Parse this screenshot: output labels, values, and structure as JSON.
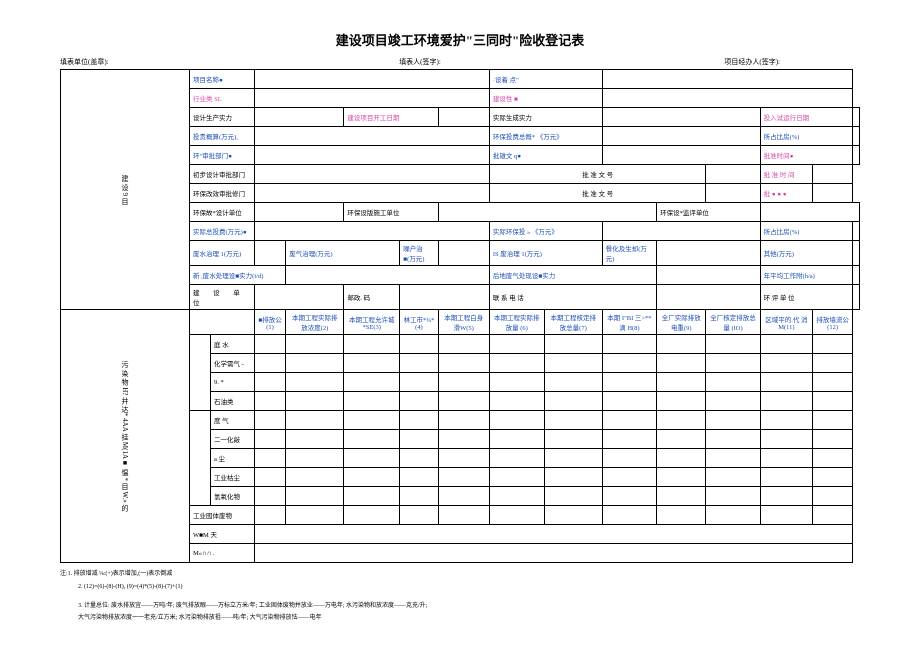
{
  "title": "建设项目竣工环境爱护\"三同时\"险收登记表",
  "header": {
    "h1": "填表单位(盖章):",
    "h2": "填表人(签字):",
    "h3": "项目经办人(签字):"
  },
  "sideA": "建 设 9 目",
  "sideB": "建 设 单 位",
  "sideC": "污 染 物 H? 并 达* 4AA 挂 M(1A■ 愠 * 目 W.» 的",
  "r": {
    "项目名称": "项目名称●",
    "设着点": "·设着          点\"",
    "行业类": "行业类 SL",
    "建设性": "建设性 ■",
    "设计生产实力": "设计生产实力",
    "建设项目开工日期": "建设项目开工日期",
    "实际生成实力": "实际生成实力",
    "投入试运行日期": "投入试运行日期",
    "投贵概算": "投贵概算(万元),",
    "环保投费总慨": "环保投费总慨* 《万元》",
    "所占比房": "所占比房(%)",
    "环审批部门": "环\"审批部门●",
    "批雄文": "批雄文 q●",
    "批准时间": "批准时间●",
    "初步设计审批部门": "初步设计审批部门",
    "批准文号1": "批    准    文    号",
    "批准时间2": "批   准   时   间",
    "环保改效审批修门": "环保改效审批修门",
    "批准文号2": "批    准    文    号",
    "批3": "批   ●   ●   ●",
    "环保故设计单位": "环保故*设计单位",
    "环保设版施工单位": "环保设版施工单位",
    "环保设监评单位": "环保设*监评单位",
    "实际总投费": "实际总投费(万元)●",
    "实际环保投": "实际环保投          » 《万元》",
    "所占比房2": "所占比房(%)",
    "废水治理": "废水治理 1(万元)",
    "废气治理": "废气治理(万元)",
    "噪户治": "噪户治■(万元)",
    "IS废治理": "IS 废治理 1(万元)",
    "餐化及生却": "餐化及生却(万元)",
    "其他": "其他(万元)",
    "新废水处理设": "新 ,废水处理设■实力(t/d)",
    "后地废气处现设": "后地废气处现设■实力",
    "年平均工作附": "年平均工作附(h/a)",
    "邮政码": "邮政. 码",
    "联系电话": "联   系   电   话",
    "环评单位": "环  评  单  位"
  },
  "cols": {
    "c1": "■排放公 (1)",
    "c2": "本期工程实际排放浓度(2)",
    "c3": "本期工程允许城*SE(3)",
    "c4": "林工市*¾* (4)",
    "c5": "本期工程白身滑W(5)",
    "c6": "本期工程实际排放量 (6)",
    "c7": "本期工程核定排放总量(7)",
    "c8": "本期 I\"BI 三>**滴 H(8)",
    "c9": "全厂实际排放电重(9)",
    "c10": "全厂核定排放总量 (IO)",
    "c11": "区域平的.代 消 M(11)",
    "c12": "排放墙流公(12)"
  },
  "rows": [
    "庭        水",
    "化学需气 -",
    "9.    *",
    "石油类",
    "度        气",
    "二一化敲",
    "a        尘",
    "工业枯尘",
    "氢氧化物",
    "工业囮体废物",
    "W■M 天",
    "M«∩∩ ."
  ],
  "notes": {
    "n1": "注:1. 排放增减 ⅛:(+)表示增加,(一)表示倒减",
    "n2": "2. (12)=(6)-(8)-(H), (9)=(4)*(5)-(8)-(7)+(1)",
    "n3": "3. 计量总位: 废水排放宜——万吨/年; 废气排放眼——万标立方米/年; 工业固体废物并放业——万电年; 水污染物和放浓度——克充/升;",
    "n4": "大气污染物排放浓度一一老充/立方米; 水污染物排放祖——吨/年; 大气污染物排放怯——电年"
  }
}
